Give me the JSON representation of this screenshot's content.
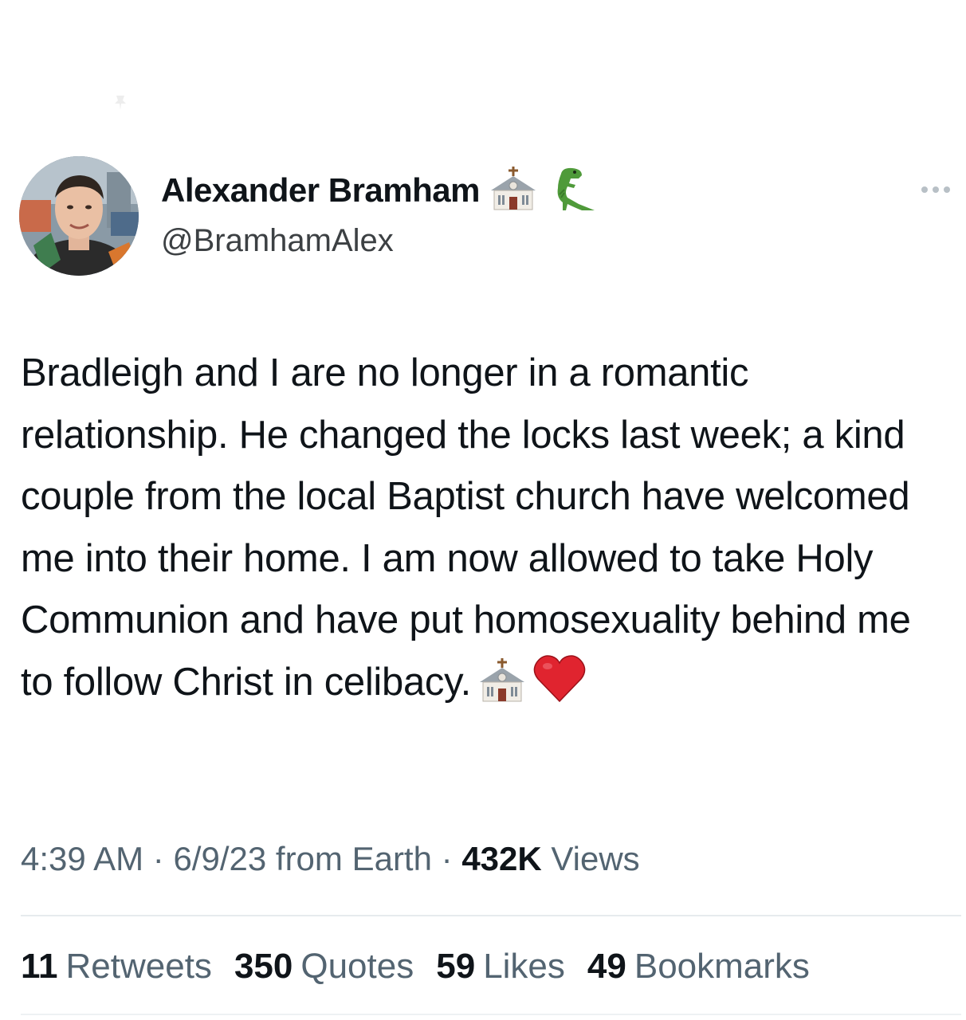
{
  "author": {
    "display_name": "Alexander Bramham",
    "handle": "@BramhamAlex",
    "badges": [
      "church-emoji",
      "t-rex-emoji"
    ]
  },
  "tweet": {
    "text": "Bradleigh and I are no longer in a romantic relationship. He changed the locks last week; a kind couple from the local Baptist church have welcomed me into their home. I am now allowed to take Holy Communion and have put homosexuality behind me to follow Christ in celibacy.",
    "trailing_emojis": [
      "church-emoji",
      "red-heart-emoji"
    ]
  },
  "meta": {
    "time": "4:39 AM",
    "date": "6/9/23",
    "source": "from Earth",
    "separator": "·",
    "views_count": "432K",
    "views_label": "Views"
  },
  "stats": {
    "retweets_count": "11",
    "retweets_label": "Retweets",
    "quotes_count": "350",
    "quotes_label": "Quotes",
    "likes_count": "59",
    "likes_label": "Likes",
    "bookmarks_count": "49",
    "bookmarks_label": "Bookmarks"
  },
  "colors": {
    "text_primary": "#0f1419",
    "text_secondary": "#536471",
    "divider": "#e6ebee"
  },
  "icons": {
    "more": "more-dots-icon"
  }
}
